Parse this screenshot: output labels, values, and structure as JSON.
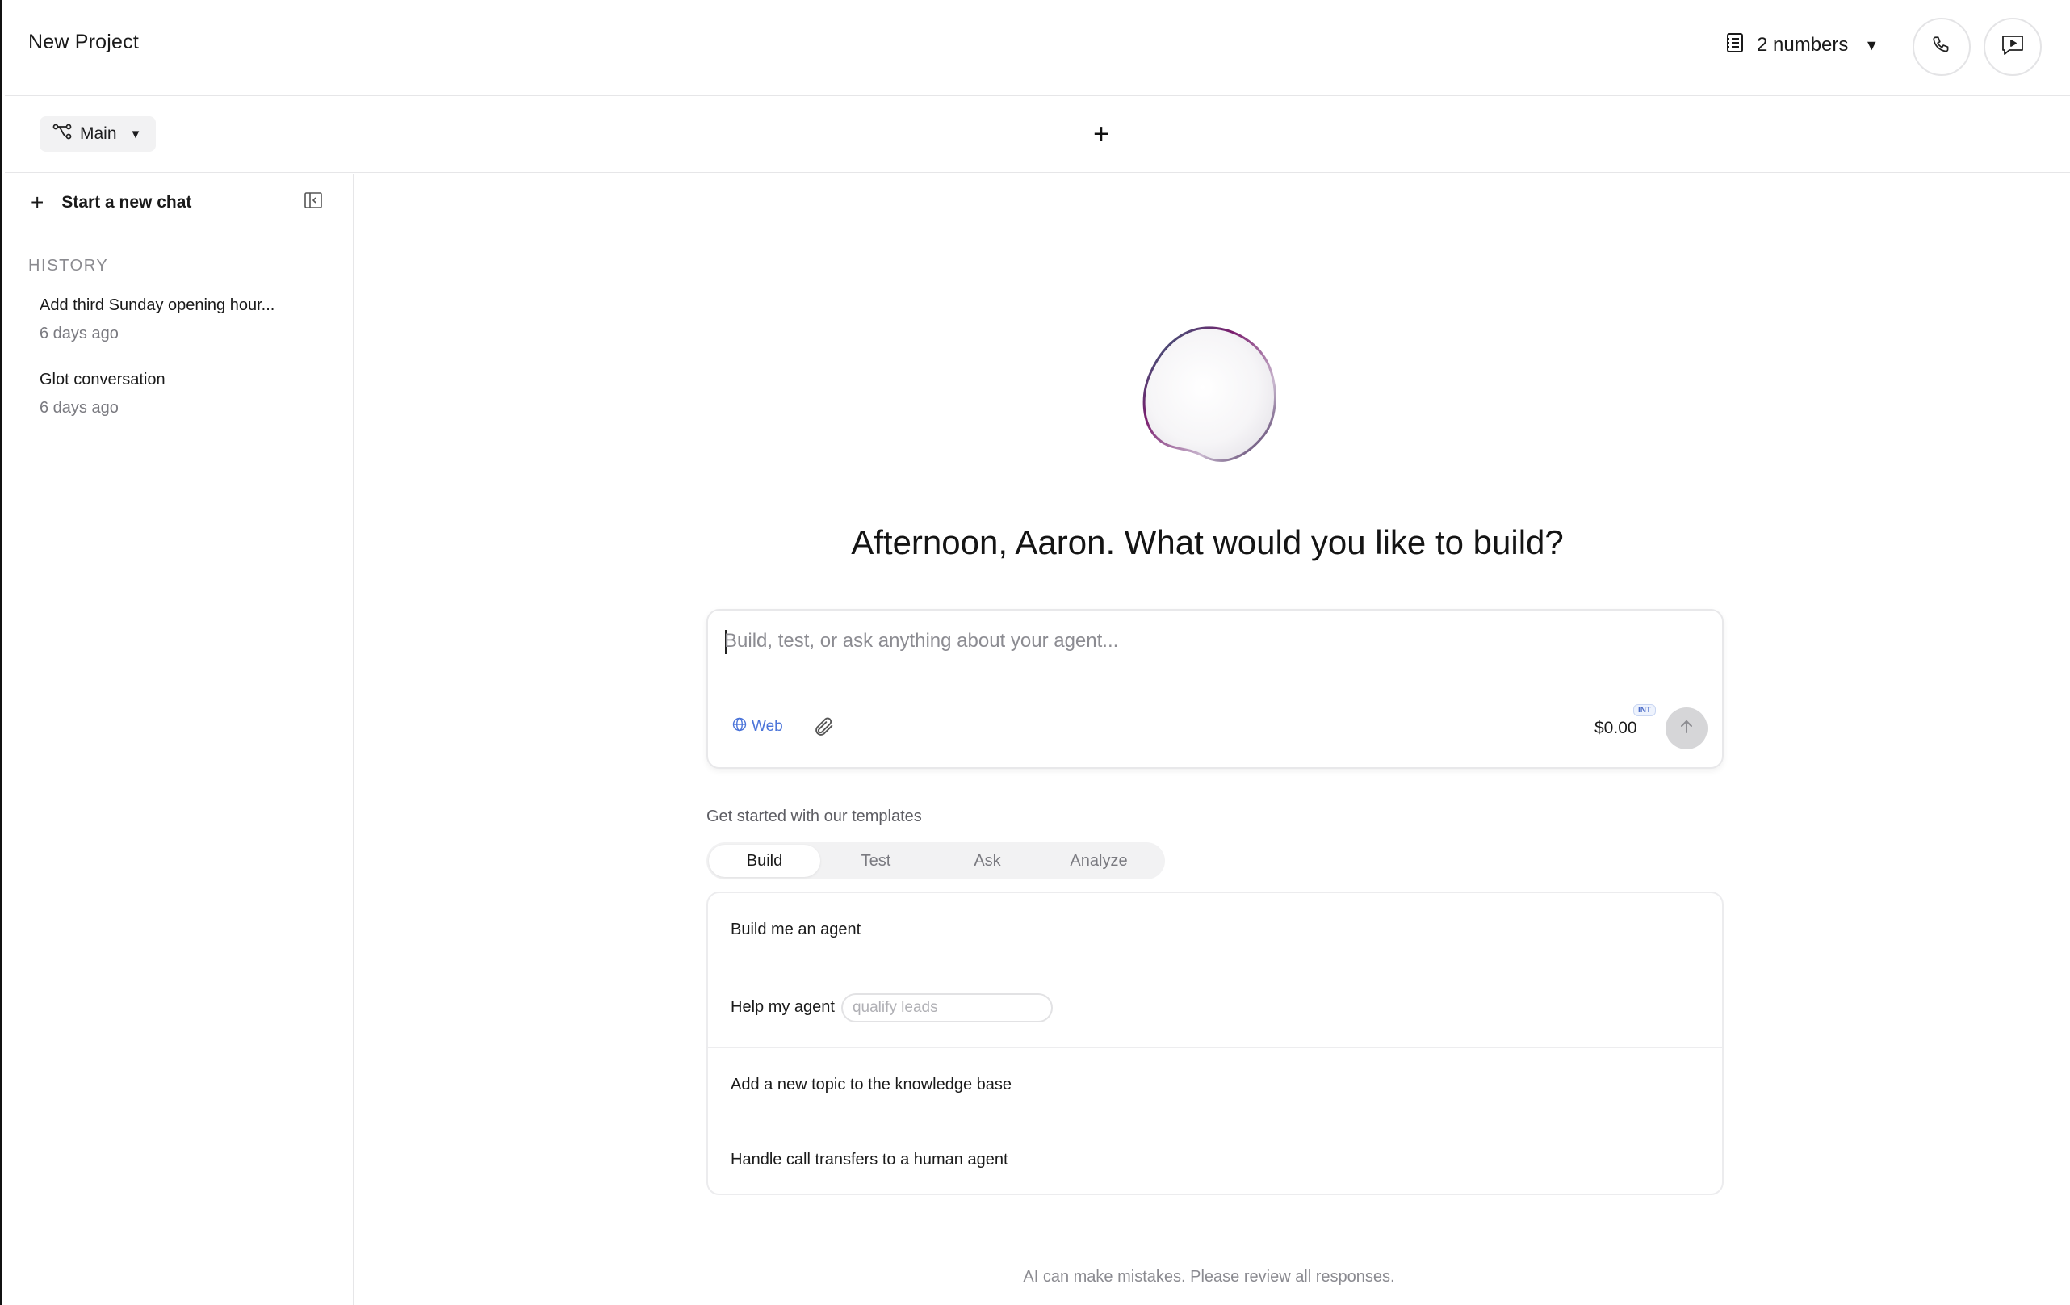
{
  "header": {
    "project_title": "New Project",
    "numbers_label": "2 numbers"
  },
  "subbar": {
    "branch_label": "Main",
    "add_tab_symbol": "+"
  },
  "sidebar": {
    "new_chat_label": "Start a new chat",
    "history_label": "HISTORY",
    "history": [
      {
        "title": "Add third Sunday opening hour...",
        "date": "6 days ago"
      },
      {
        "title": "Glot conversation",
        "date": "6 days ago"
      }
    ]
  },
  "main": {
    "greeting": "Afternoon, Aaron. What would you like to build?",
    "composer": {
      "placeholder": "Build, test, or ask anything about your agent...",
      "web_label": "Web",
      "cost": "$0.00",
      "badge": "INT"
    },
    "templates_label": "Get started with our templates",
    "tabs": [
      "Build",
      "Test",
      "Ask",
      "Analyze"
    ],
    "active_tab": "Build",
    "templates": [
      {
        "label": "Build me an agent"
      },
      {
        "label": "Help my agent",
        "input_placeholder": "qualify leads"
      },
      {
        "label": "Add a new topic to the knowledge base"
      },
      {
        "label": "Handle call transfers to a human agent"
      }
    ],
    "disclaimer": "AI can make mistakes. Please review all responses."
  },
  "colors": {
    "accent_blue": "#4b74d9",
    "border": "#e6e6e8",
    "orb_rim": "#7a1d6e"
  },
  "icons": [
    "document-list-icon",
    "caret-down-icon",
    "phone-icon",
    "chat-play-icon",
    "branch-icon",
    "plus-icon",
    "sidebar-collapse-icon",
    "globe-icon",
    "paperclip-icon",
    "arrow-up-icon"
  ]
}
